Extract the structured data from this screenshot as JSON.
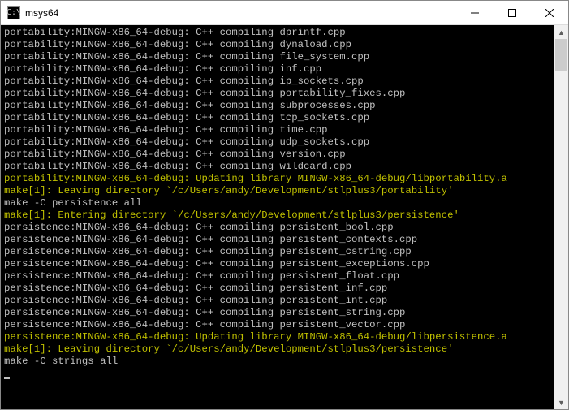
{
  "window": {
    "icon_glyph": "C:\\",
    "title": "msys64"
  },
  "colors": {
    "console_bg": "#000000",
    "console_fg": "#c0c0c0",
    "highlight": "#c0c000"
  },
  "lines": [
    {
      "style": "plain",
      "text": "portability:MINGW-x86_64-debug: C++ compiling dprintf.cpp"
    },
    {
      "style": "plain",
      "text": "portability:MINGW-x86_64-debug: C++ compiling dynaload.cpp"
    },
    {
      "style": "plain",
      "text": "portability:MINGW-x86_64-debug: C++ compiling file_system.cpp"
    },
    {
      "style": "plain",
      "text": "portability:MINGW-x86_64-debug: C++ compiling inf.cpp"
    },
    {
      "style": "plain",
      "text": "portability:MINGW-x86_64-debug: C++ compiling ip_sockets.cpp"
    },
    {
      "style": "plain",
      "text": "portability:MINGW-x86_64-debug: C++ compiling portability_fixes.cpp"
    },
    {
      "style": "plain",
      "text": "portability:MINGW-x86_64-debug: C++ compiling subprocesses.cpp"
    },
    {
      "style": "plain",
      "text": "portability:MINGW-x86_64-debug: C++ compiling tcp_sockets.cpp"
    },
    {
      "style": "plain",
      "text": "portability:MINGW-x86_64-debug: C++ compiling time.cpp"
    },
    {
      "style": "plain",
      "text": "portability:MINGW-x86_64-debug: C++ compiling udp_sockets.cpp"
    },
    {
      "style": "plain",
      "text": "portability:MINGW-x86_64-debug: C++ compiling version.cpp"
    },
    {
      "style": "plain",
      "text": "portability:MINGW-x86_64-debug: C++ compiling wildcard.cpp"
    },
    {
      "style": "yellow",
      "text": "portability:MINGW-x86_64-debug: Updating library MINGW-x86_64-debug/libportability.a"
    },
    {
      "style": "yellow",
      "text": "make[1]: Leaving directory `/c/Users/andy/Development/stlplus3/portability'"
    },
    {
      "style": "plain",
      "text": "make -C persistence all"
    },
    {
      "style": "yellow",
      "text": "make[1]: Entering directory `/c/Users/andy/Development/stlplus3/persistence'"
    },
    {
      "style": "plain",
      "text": "persistence:MINGW-x86_64-debug: C++ compiling persistent_bool.cpp"
    },
    {
      "style": "plain",
      "text": "persistence:MINGW-x86_64-debug: C++ compiling persistent_contexts.cpp"
    },
    {
      "style": "plain",
      "text": "persistence:MINGW-x86_64-debug: C++ compiling persistent_cstring.cpp"
    },
    {
      "style": "plain",
      "text": "persistence:MINGW-x86_64-debug: C++ compiling persistent_exceptions.cpp"
    },
    {
      "style": "plain",
      "text": "persistence:MINGW-x86_64-debug: C++ compiling persistent_float.cpp"
    },
    {
      "style": "plain",
      "text": "persistence:MINGW-x86_64-debug: C++ compiling persistent_inf.cpp"
    },
    {
      "style": "plain",
      "text": "persistence:MINGW-x86_64-debug: C++ compiling persistent_int.cpp"
    },
    {
      "style": "plain",
      "text": "persistence:MINGW-x86_64-debug: C++ compiling persistent_string.cpp"
    },
    {
      "style": "plain",
      "text": "persistence:MINGW-x86_64-debug: C++ compiling persistent_vector.cpp"
    },
    {
      "style": "yellow",
      "text": "persistence:MINGW-x86_64-debug: Updating library MINGW-x86_64-debug/libpersistence.a"
    },
    {
      "style": "yellow",
      "text": "make[1]: Leaving directory `/c/Users/andy/Development/stlplus3/persistence'"
    },
    {
      "style": "plain",
      "text": "make -C strings all"
    }
  ]
}
